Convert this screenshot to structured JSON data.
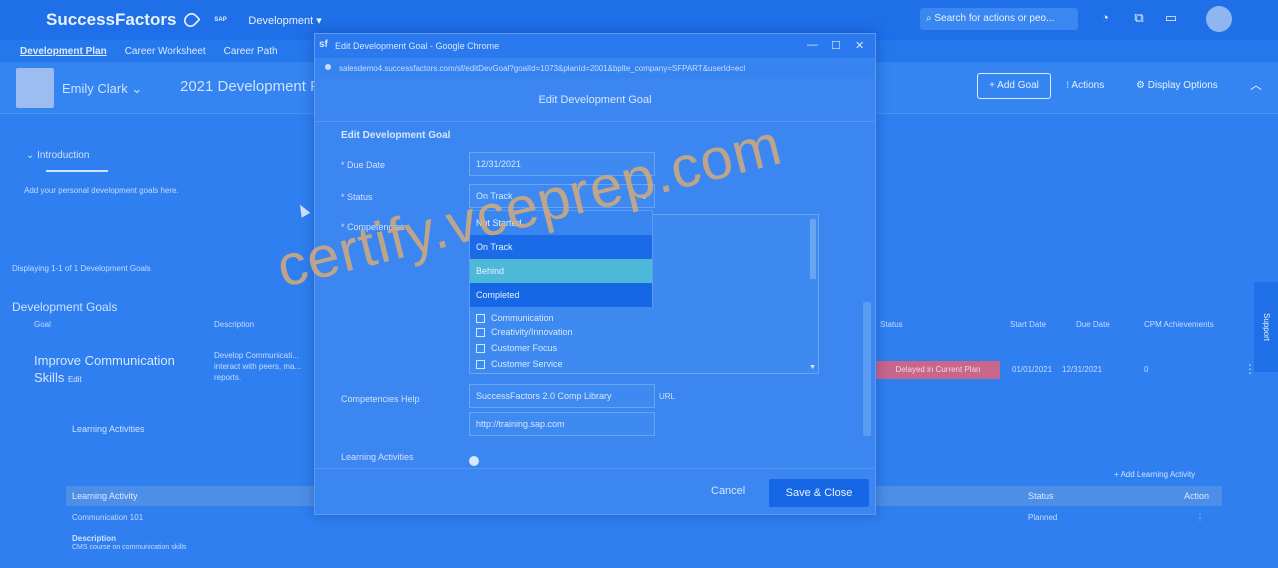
{
  "shell": {
    "logo": "SuccessFactors",
    "sap_logo": "SAP",
    "module": "Development ▾",
    "search_placeholder": "Search for actions or peo..."
  },
  "subnav": [
    "Development Plan",
    "Career Worksheet",
    "Career Path"
  ],
  "header": {
    "employee": "Emily Clark  ⌄",
    "plan_title": "2021 Development Pl",
    "add_goal": "+ Add Goal",
    "actions": "⁝ Actions",
    "display_options": "⚙ Display Options"
  },
  "page": {
    "intro_toggle": "⌄   Introduction",
    "intro_text": "Add your personal development goals here.",
    "displaying": "Displaying 1-1 of 1 Development Goals",
    "section_title": "Development Goals",
    "columns": {
      "goal": "Goal",
      "description": "Description",
      "status": "Status",
      "start": "Start Date",
      "due": "Due Date",
      "cpm": "CPM Achievements"
    },
    "goal": {
      "name": "Improve Communication Skills",
      "edit": "Edit",
      "description": "Develop Communicati... interact with peers, ma... reports.",
      "status": "Delayed in Current Plan",
      "start": "01/01/2021",
      "due": "12/31/2021",
      "cpm": "0"
    },
    "learning_title": "Learning Activities",
    "add_learning": "+ Add Learning Activity",
    "la_headers": {
      "activity": "Learning Activity",
      "status": "Status",
      "action": "Action"
    },
    "la_row": {
      "activity": "Communication 101",
      "status": "Planned"
    },
    "la_desc_label": "Description",
    "la_desc": "CMS course on communication skills",
    "support": "Support"
  },
  "dialog": {
    "window_title": "Edit Development Goal - Google Chrome",
    "url": "salesdemo4.successfactors.com/sf/editDevGoal?goalId=1073&planId=2001&bplte_company=SFPART&userId=ecl",
    "header": "Edit Development Goal",
    "section": "Edit Development Goal",
    "due_date_label": "* Due Date",
    "due_date_value": "12/31/2021",
    "status_label": "* Status",
    "status_value": "On Track",
    "competencies_label": "* Competencies",
    "status_options": [
      "Not Started",
      "On Track",
      "Behind",
      "Completed"
    ],
    "competencies": [
      "Creativity/Innovation",
      "Customer Focus",
      "Customer Service"
    ],
    "comp_partial": "Communication",
    "comp_help_label": "Competencies Help",
    "comp_help_value": "SuccessFactors 2.0 Comp Library",
    "url_label": "URL",
    "help_url_value": "http://training.sap.com",
    "learning_label": "Learning Activities",
    "cancel": "Cancel",
    "save_close": "Save & Close"
  },
  "watermark": "certify.vceprep.com",
  "colors": {
    "overlay_blue": "#2f7ff0",
    "save_button": "#1667e6",
    "status_delayed": "#c9668b",
    "watermark": "#d6aa78"
  }
}
